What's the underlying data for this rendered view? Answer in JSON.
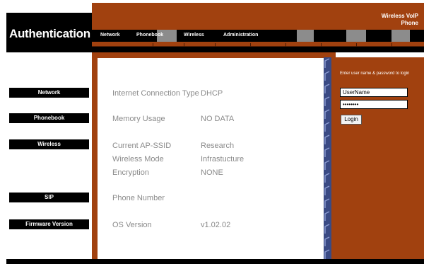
{
  "header": {
    "title": "Authentication",
    "product_name": "Wireless VoIP Phone",
    "tabs": [
      "Network",
      "Phonebook",
      "Wireless",
      "Administration"
    ]
  },
  "sidebar": {
    "items": [
      "Network",
      "Phonebook",
      "Wireless",
      "SIP",
      "Firmware Version"
    ]
  },
  "status": {
    "rows": [
      {
        "label": "Internet Connection Type",
        "value": "DHCP"
      },
      {
        "label": "Memory Usage",
        "value": "NO DATA"
      },
      {
        "label": "Current AP-SSID",
        "value": "Research"
      },
      {
        "label": "Wireless Mode",
        "value": "Infrastucture"
      },
      {
        "label": "Encryption",
        "value": "NONE"
      },
      {
        "label": "Phone Number",
        "value": ""
      },
      {
        "label": "OS Version",
        "value": "v1.02.02"
      }
    ]
  },
  "login": {
    "prompt": "Enter user name & password to login",
    "username_value": "UserName",
    "password_value": "••••••••",
    "button_label": "Login"
  },
  "colors": {
    "brand": "#a1410f",
    "divider": "#3a4a84"
  },
  "icons": {
    "divider": "chevron-stripe-icon"
  }
}
